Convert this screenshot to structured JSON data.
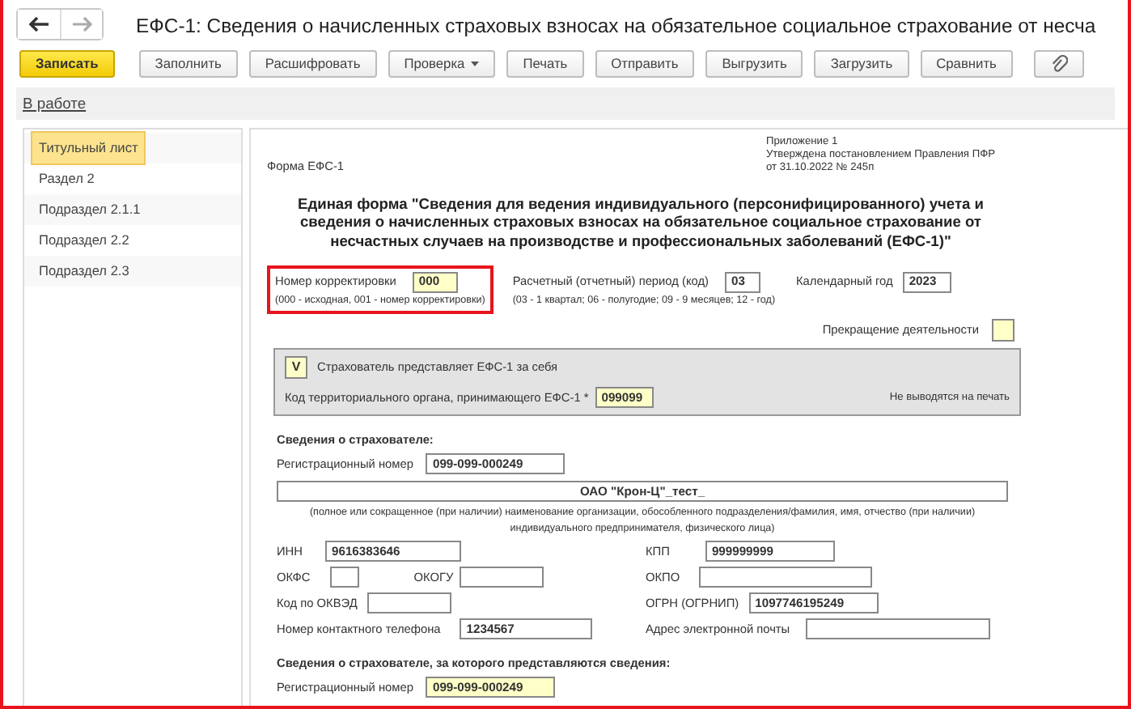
{
  "window": {
    "title": "ЕФС-1: Сведения о начисленных страховых взносах на обязательное социальное страхование от несча"
  },
  "toolbar": {
    "buttons": [
      {
        "label": "Записать",
        "kind": "primary"
      },
      {
        "label": "Заполнить",
        "kind": "default"
      },
      {
        "label": "Расшифровать",
        "kind": "default"
      },
      {
        "label": "Проверка",
        "kind": "dropdown"
      },
      {
        "label": "Печать",
        "kind": "default"
      },
      {
        "label": "Отправить",
        "kind": "default"
      },
      {
        "label": "Выгрузить",
        "kind": "default"
      },
      {
        "label": "Загрузить",
        "kind": "default"
      },
      {
        "label": "Сравнить",
        "kind": "default"
      },
      {
        "kind": "attach"
      }
    ]
  },
  "status_link": "В работе",
  "sections": [
    {
      "label": "Титульный лист",
      "selected": true
    },
    {
      "label": "Раздел 2",
      "selected": false
    },
    {
      "label": "Подраздел 2.1.1",
      "selected": false
    },
    {
      "label": "Подраздел 2.2",
      "selected": false
    },
    {
      "label": "Подраздел 2.3",
      "selected": false
    }
  ],
  "form": {
    "form_name": "Форма ЕФС-1",
    "approval": [
      "Приложение 1",
      "Утверждена постановлением Правления ПФР",
      "от 31.10.2022 № 245п"
    ],
    "heading": "Единая форма \"Сведения для ведения индивидуального (персонифицированного) учета и сведения о начисленных страховых взносах на обязательное социальное страхование от несчастных случаев на производстве и профессиональных заболеваний (ЕФС-1)\"",
    "correction": {
      "label": "Номер корректировки",
      "value": "000",
      "editable": true,
      "hint": "(000 - исходная, 001 - номер корректировки)",
      "highlighted": true
    },
    "period": {
      "label": "Расчетный (отчетный) период (код)",
      "value": "03",
      "editable": false,
      "hint": "(03 - 1 квартал; 06 - полугодие; 09 - 9 месяцев; 12 - год)"
    },
    "year": {
      "label": "Календарный год",
      "value": "2023",
      "editable": false
    },
    "termination": {
      "label": "Прекращение деятельности",
      "checked": false
    },
    "self_submission": {
      "checked": true,
      "mark": "V",
      "label": "Страхователь представляет ЕФС-1 за себя",
      "code_label": "Код территориального органа, принимающего ЕФС-1 *",
      "code_value": "099099",
      "code_editable": true,
      "note": "Не выводятся на печать"
    },
    "insurer": {
      "title": "Сведения о страхователе:",
      "reg_number": {
        "label": "Регистрационный номер",
        "value": "099-099-000249",
        "editable": false
      },
      "name": {
        "value": "ОАО \"Крон-Ц\"_тест_",
        "hint": "(полное или сокращенное (при наличии) наименование организации, обособленного подразделения/фамилия, имя, отчество (при наличии) индивидуального предпринимателя, физического лица)"
      },
      "inn": {
        "label": "ИНН",
        "value": "9616383646",
        "editable": false
      },
      "kpp": {
        "label": "КПП",
        "value": "999999999",
        "editable": false
      },
      "okfs": {
        "label": "ОКФС",
        "editable": false
      },
      "okogu": {
        "label": "ОКОГУ",
        "editable": false
      },
      "okpo": {
        "label": "ОКПО",
        "editable": false
      },
      "okved": {
        "label": "Код по ОКВЭД",
        "editable": false
      },
      "ogrn": {
        "label": "ОГРН (ОГРНИП)",
        "value": "1097746195249",
        "editable": false
      },
      "phone": {
        "label": "Номер контактного телефона",
        "value": "1234567",
        "editable": false
      },
      "email": {
        "label": "Адрес электронной почты",
        "editable": false
      }
    },
    "represented": {
      "title": "Сведения о страхователе, за которого представляются сведения:",
      "reg_number": {
        "label": "Регистрационный номер",
        "value": "099-099-000249",
        "editable": true
      }
    }
  }
}
